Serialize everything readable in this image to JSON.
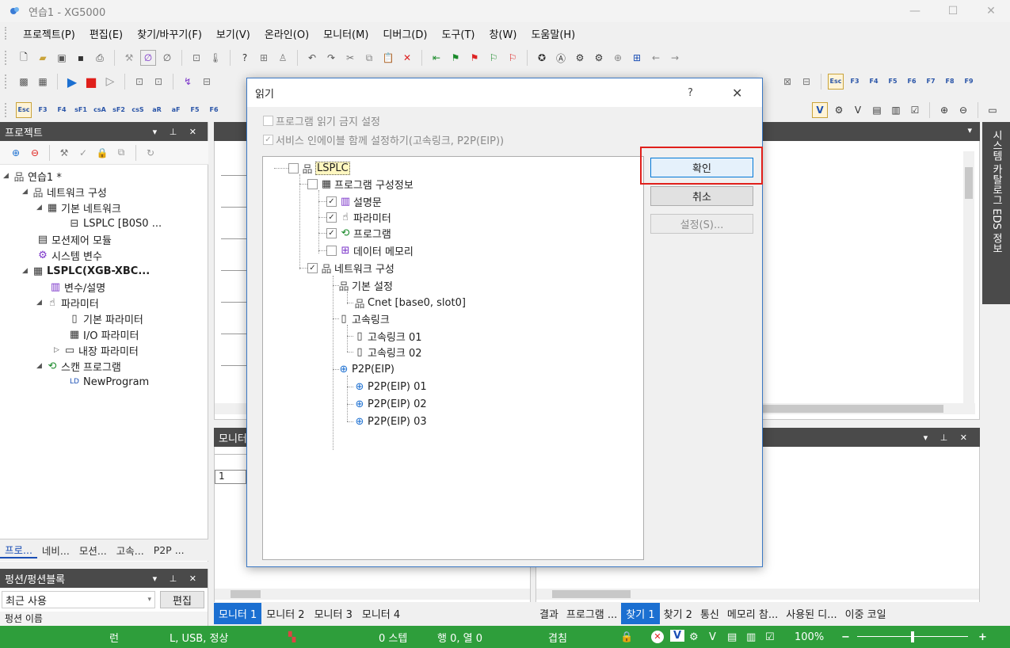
{
  "window": {
    "title": "연습1 - XG5000",
    "minimize": "—",
    "maximize": "☐",
    "close": "✕"
  },
  "menu": [
    "프로젝트(P)",
    "편집(E)",
    "찾기/바꾸기(F)",
    "보기(V)",
    "온라인(O)",
    "모니터(M)",
    "디버그(D)",
    "도구(T)",
    "창(W)",
    "도움말(H)"
  ],
  "toolbar_keys": [
    "Esc",
    "F3",
    "F4",
    "sF1",
    "csA",
    "sF2",
    "csS",
    "aR",
    "aF",
    "F5",
    "F6"
  ],
  "toolbar_keys_right": [
    "Esc",
    "F3",
    "F4",
    "F5",
    "F6",
    "F7",
    "F8",
    "F9"
  ],
  "project_pane": {
    "title": "프로젝트",
    "tree": [
      {
        "label": "연습1 *",
        "icon": "network-icon"
      },
      {
        "label": "네트워크 구성",
        "icon": "network-icon"
      },
      {
        "label": "기본 네트워크",
        "icon": "grid-icon"
      },
      {
        "label": "LSPLC [B0S0 ...",
        "icon": "plc-icon"
      },
      {
        "label": "모션제어 모듈",
        "icon": "module-icon"
      },
      {
        "label": "시스템 변수",
        "icon": "variable-icon"
      },
      {
        "label": "LSPLC(XGB-XBC...",
        "icon": "grid-icon"
      },
      {
        "label": "변수/설명",
        "icon": "variable-icon"
      },
      {
        "label": "파라미터",
        "icon": "parameter-icon"
      },
      {
        "label": "기본 파라미터",
        "icon": "document-icon"
      },
      {
        "label": "I/O 파라미터",
        "icon": "io-icon"
      },
      {
        "label": "내장 파라미터",
        "icon": "module-icon"
      },
      {
        "label": "스캔 프로그램",
        "icon": "program-icon"
      },
      {
        "label": "NewProgram",
        "icon": "ld-icon"
      }
    ],
    "tabs": [
      "프로...",
      "네비...",
      "모션...",
      "고속...",
      "P2P ..."
    ]
  },
  "fb_pane": {
    "title": "펑션/펑션블록",
    "combo_value": "최근 사용",
    "edit_button": "편집",
    "row": "펑션 이름"
  },
  "side_tab": "시스템 카탈로그  EDS 정보",
  "monitor_pane": {
    "title": "모니터",
    "row1": "1",
    "tabs": [
      "모니터 1",
      "모니터 2",
      "모니터 3",
      "모니터 4"
    ],
    "active_tab": 0
  },
  "result_pane": {
    "tabs": [
      "결과",
      "프로그램 ...",
      "찾기 1",
      "찾기 2",
      "통신",
      "메모리 참...",
      "사용된 디...",
      "이중 코일"
    ],
    "active_tab": 2
  },
  "status": {
    "mode": "런",
    "connection": "L, USB, 정상",
    "step": "0 스텝",
    "position": "행 0, 열 0",
    "overwrite": "겹침",
    "zoom": "100%",
    "minus": "−",
    "plus": "+"
  },
  "dialog": {
    "title": "읽기",
    "help": "?",
    "close": "✕",
    "opt1": "프로그램 읽기 금지 설정",
    "opt2": "서비스 인에이블 함께 설정하기(고속링크, P2P(EIP))",
    "ok": "확인",
    "cancel": "취소",
    "settings": "설정(S)...",
    "tree": {
      "root": "LSPLC",
      "config": "프로그램 구성정보",
      "comment": "설명문",
      "param": "파라미터",
      "program": "프로그램",
      "datamem": "데이터 메모리",
      "network": "네트워크 구성",
      "basic": "기본 설정",
      "cnet": "Cnet [base0, slot0]",
      "hslink": "고속링크",
      "hs1": "고속링크 01",
      "hs2": "고속링크 02",
      "p2p": "P2P(EIP)",
      "p1": "P2P(EIP) 01",
      "p2": "P2P(EIP) 02",
      "p3": "P2P(EIP) 03"
    }
  },
  "colors": {
    "status_bar": "#2e9e3b",
    "pane_header": "#4a4a4a",
    "highlight": "#e0201b",
    "accent": "#1b6fd1"
  }
}
